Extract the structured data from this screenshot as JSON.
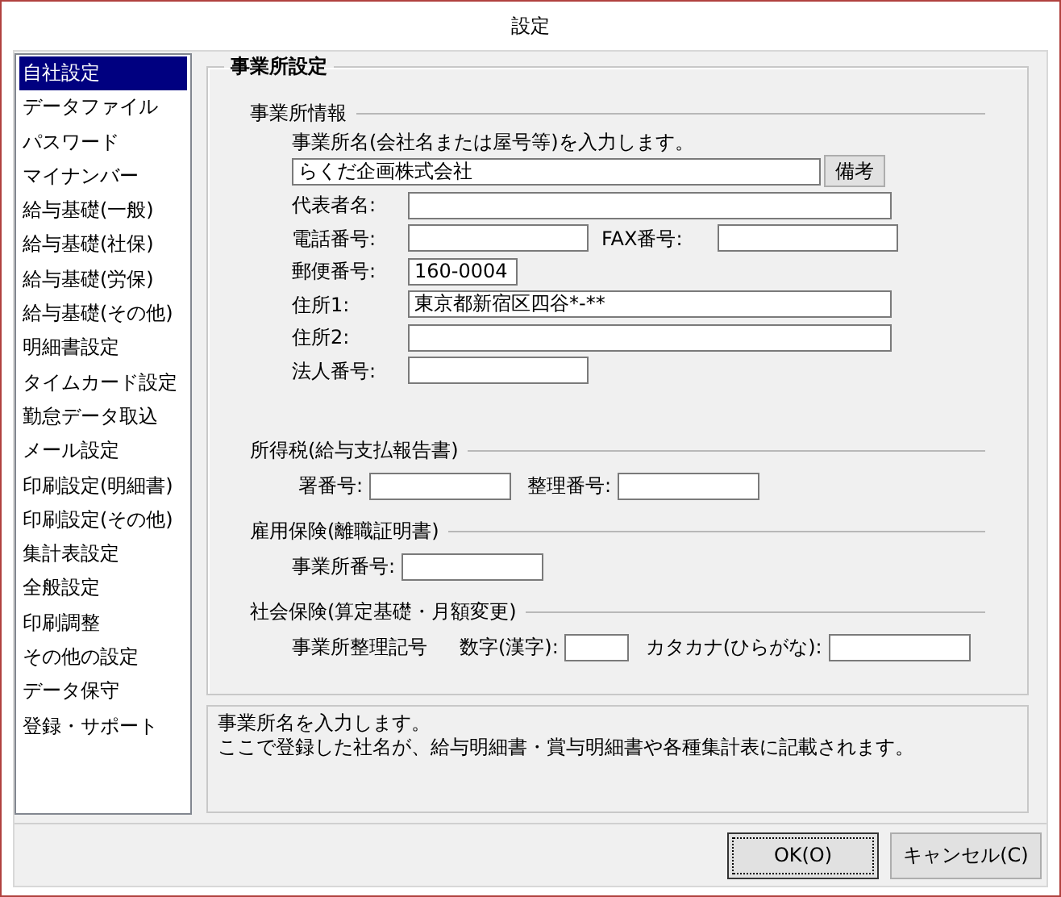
{
  "window": {
    "title": "設定"
  },
  "sidebar": {
    "items": [
      {
        "label": "自社設定",
        "selected": true
      },
      {
        "label": "データファイル",
        "selected": false
      },
      {
        "label": "パスワード",
        "selected": false
      },
      {
        "label": "マイナンバー",
        "selected": false
      },
      {
        "label": "給与基礎(一般)",
        "selected": false
      },
      {
        "label": "給与基礎(社保)",
        "selected": false
      },
      {
        "label": "給与基礎(労保)",
        "selected": false
      },
      {
        "label": "給与基礎(その他)",
        "selected": false
      },
      {
        "label": "明細書設定",
        "selected": false
      },
      {
        "label": "タイムカード設定",
        "selected": false
      },
      {
        "label": "勤怠データ取込",
        "selected": false
      },
      {
        "label": "メール設定",
        "selected": false
      },
      {
        "label": "印刷設定(明細書)",
        "selected": false
      },
      {
        "label": "印刷設定(その他)",
        "selected": false
      },
      {
        "label": "集計表設定",
        "selected": false
      },
      {
        "label": "全般設定",
        "selected": false
      },
      {
        "label": "印刷調整",
        "selected": false
      },
      {
        "label": "その他の設定",
        "selected": false
      },
      {
        "label": "データ保守",
        "selected": false
      },
      {
        "label": "登録・サポート",
        "selected": false
      }
    ]
  },
  "group": {
    "title": "事業所設定",
    "company": {
      "title": "事業所情報",
      "note": "事業所名(会社名または屋号等)を入力します。",
      "name_value": "らくだ企画株式会社",
      "memo_button": "備考",
      "rows": [
        [
          {
            "label": "代表者名:",
            "kind": "wide"
          }
        ],
        [
          {
            "label": "電話番号:",
            "kind": "medium"
          },
          {
            "label": "FAX番号:",
            "kind": "medium"
          }
        ],
        [
          {
            "label": "郵便番号:",
            "kind": "short",
            "value": "160-0004"
          }
        ],
        [
          {
            "label": "住所1:",
            "kind": "wide",
            "value": "東京都新宿区四谷*-**"
          }
        ],
        [
          {
            "label": "住所2:",
            "kind": "wide"
          }
        ],
        [
          {
            "label": "法人番号:",
            "kind": "medium"
          }
        ]
      ]
    },
    "sections": [
      {
        "title": "所得税(給与支払報告書)",
        "rows": [
          [
            {
              "label": "署番号:",
              "kind": "small"
            },
            {
              "label": "整理番号:",
              "kind": "small"
            }
          ]
        ]
      },
      {
        "title": "雇用保険(離職証明書)",
        "rows": [
          [
            {
              "label": "事業所番号:",
              "kind": "small"
            }
          ]
        ]
      },
      {
        "title": "社会保険(算定基礎・月額変更)",
        "caption": "事業所整理記号",
        "rows": [
          [
            {
              "label": "数字(漢字):",
              "kind": "tiny"
            },
            {
              "label": "カタカナ(ひらがな):",
              "kind": "small"
            }
          ]
        ]
      }
    ]
  },
  "help": {
    "lines": [
      "事業所名を入力します。",
      "ここで登録した社名が、給与明細書・賞与明細書や各種集計表に記載されます。"
    ]
  },
  "buttons": [
    {
      "label": "OK(O)",
      "default": true
    },
    {
      "label": "キャンセル(C)",
      "default": false
    }
  ]
}
